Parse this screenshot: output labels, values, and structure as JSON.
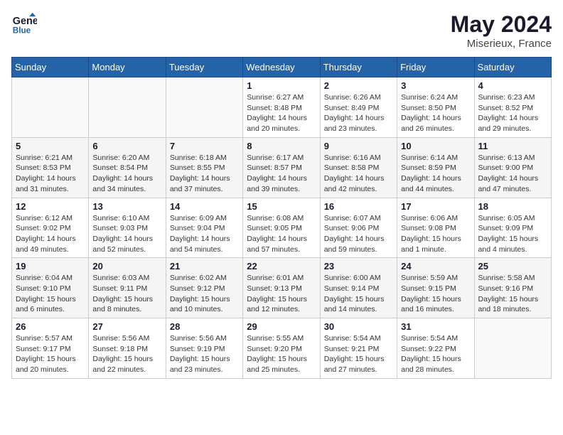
{
  "header": {
    "logo_line1": "General",
    "logo_line2": "Blue",
    "month_year": "May 2024",
    "location": "Miserieux, France"
  },
  "weekdays": [
    "Sunday",
    "Monday",
    "Tuesday",
    "Wednesday",
    "Thursday",
    "Friday",
    "Saturday"
  ],
  "weeks": [
    [
      {
        "day": "",
        "info": ""
      },
      {
        "day": "",
        "info": ""
      },
      {
        "day": "",
        "info": ""
      },
      {
        "day": "1",
        "info": "Sunrise: 6:27 AM\nSunset: 8:48 PM\nDaylight: 14 hours\nand 20 minutes."
      },
      {
        "day": "2",
        "info": "Sunrise: 6:26 AM\nSunset: 8:49 PM\nDaylight: 14 hours\nand 23 minutes."
      },
      {
        "day": "3",
        "info": "Sunrise: 6:24 AM\nSunset: 8:50 PM\nDaylight: 14 hours\nand 26 minutes."
      },
      {
        "day": "4",
        "info": "Sunrise: 6:23 AM\nSunset: 8:52 PM\nDaylight: 14 hours\nand 29 minutes."
      }
    ],
    [
      {
        "day": "5",
        "info": "Sunrise: 6:21 AM\nSunset: 8:53 PM\nDaylight: 14 hours\nand 31 minutes."
      },
      {
        "day": "6",
        "info": "Sunrise: 6:20 AM\nSunset: 8:54 PM\nDaylight: 14 hours\nand 34 minutes."
      },
      {
        "day": "7",
        "info": "Sunrise: 6:18 AM\nSunset: 8:55 PM\nDaylight: 14 hours\nand 37 minutes."
      },
      {
        "day": "8",
        "info": "Sunrise: 6:17 AM\nSunset: 8:57 PM\nDaylight: 14 hours\nand 39 minutes."
      },
      {
        "day": "9",
        "info": "Sunrise: 6:16 AM\nSunset: 8:58 PM\nDaylight: 14 hours\nand 42 minutes."
      },
      {
        "day": "10",
        "info": "Sunrise: 6:14 AM\nSunset: 8:59 PM\nDaylight: 14 hours\nand 44 minutes."
      },
      {
        "day": "11",
        "info": "Sunrise: 6:13 AM\nSunset: 9:00 PM\nDaylight: 14 hours\nand 47 minutes."
      }
    ],
    [
      {
        "day": "12",
        "info": "Sunrise: 6:12 AM\nSunset: 9:02 PM\nDaylight: 14 hours\nand 49 minutes."
      },
      {
        "day": "13",
        "info": "Sunrise: 6:10 AM\nSunset: 9:03 PM\nDaylight: 14 hours\nand 52 minutes."
      },
      {
        "day": "14",
        "info": "Sunrise: 6:09 AM\nSunset: 9:04 PM\nDaylight: 14 hours\nand 54 minutes."
      },
      {
        "day": "15",
        "info": "Sunrise: 6:08 AM\nSunset: 9:05 PM\nDaylight: 14 hours\nand 57 minutes."
      },
      {
        "day": "16",
        "info": "Sunrise: 6:07 AM\nSunset: 9:06 PM\nDaylight: 14 hours\nand 59 minutes."
      },
      {
        "day": "17",
        "info": "Sunrise: 6:06 AM\nSunset: 9:08 PM\nDaylight: 15 hours\nand 1 minute."
      },
      {
        "day": "18",
        "info": "Sunrise: 6:05 AM\nSunset: 9:09 PM\nDaylight: 15 hours\nand 4 minutes."
      }
    ],
    [
      {
        "day": "19",
        "info": "Sunrise: 6:04 AM\nSunset: 9:10 PM\nDaylight: 15 hours\nand 6 minutes."
      },
      {
        "day": "20",
        "info": "Sunrise: 6:03 AM\nSunset: 9:11 PM\nDaylight: 15 hours\nand 8 minutes."
      },
      {
        "day": "21",
        "info": "Sunrise: 6:02 AM\nSunset: 9:12 PM\nDaylight: 15 hours\nand 10 minutes."
      },
      {
        "day": "22",
        "info": "Sunrise: 6:01 AM\nSunset: 9:13 PM\nDaylight: 15 hours\nand 12 minutes."
      },
      {
        "day": "23",
        "info": "Sunrise: 6:00 AM\nSunset: 9:14 PM\nDaylight: 15 hours\nand 14 minutes."
      },
      {
        "day": "24",
        "info": "Sunrise: 5:59 AM\nSunset: 9:15 PM\nDaylight: 15 hours\nand 16 minutes."
      },
      {
        "day": "25",
        "info": "Sunrise: 5:58 AM\nSunset: 9:16 PM\nDaylight: 15 hours\nand 18 minutes."
      }
    ],
    [
      {
        "day": "26",
        "info": "Sunrise: 5:57 AM\nSunset: 9:17 PM\nDaylight: 15 hours\nand 20 minutes."
      },
      {
        "day": "27",
        "info": "Sunrise: 5:56 AM\nSunset: 9:18 PM\nDaylight: 15 hours\nand 22 minutes."
      },
      {
        "day": "28",
        "info": "Sunrise: 5:56 AM\nSunset: 9:19 PM\nDaylight: 15 hours\nand 23 minutes."
      },
      {
        "day": "29",
        "info": "Sunrise: 5:55 AM\nSunset: 9:20 PM\nDaylight: 15 hours\nand 25 minutes."
      },
      {
        "day": "30",
        "info": "Sunrise: 5:54 AM\nSunset: 9:21 PM\nDaylight: 15 hours\nand 27 minutes."
      },
      {
        "day": "31",
        "info": "Sunrise: 5:54 AM\nSunset: 9:22 PM\nDaylight: 15 hours\nand 28 minutes."
      },
      {
        "day": "",
        "info": ""
      }
    ]
  ]
}
